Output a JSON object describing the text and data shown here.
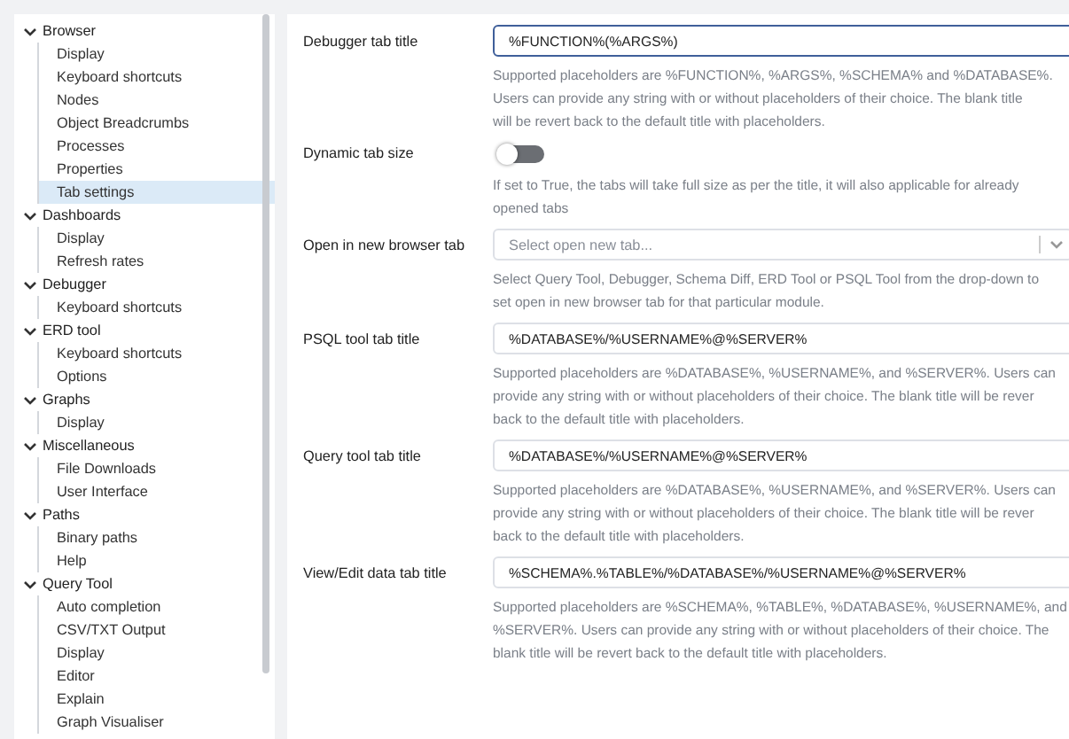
{
  "sidebar": {
    "items": [
      {
        "label": "Browser",
        "expanded": true,
        "children": [
          {
            "label": "Display",
            "selected": false
          },
          {
            "label": "Keyboard shortcuts",
            "selected": false
          },
          {
            "label": "Nodes",
            "selected": false
          },
          {
            "label": "Object Breadcrumbs",
            "selected": false
          },
          {
            "label": "Processes",
            "selected": false
          },
          {
            "label": "Properties",
            "selected": false
          },
          {
            "label": "Tab settings",
            "selected": true
          }
        ]
      },
      {
        "label": "Dashboards",
        "expanded": true,
        "children": [
          {
            "label": "Display",
            "selected": false
          },
          {
            "label": "Refresh rates",
            "selected": false
          }
        ]
      },
      {
        "label": "Debugger",
        "expanded": true,
        "children": [
          {
            "label": "Keyboard shortcuts",
            "selected": false
          }
        ]
      },
      {
        "label": "ERD tool",
        "expanded": true,
        "children": [
          {
            "label": "Keyboard shortcuts",
            "selected": false
          },
          {
            "label": "Options",
            "selected": false
          }
        ]
      },
      {
        "label": "Graphs",
        "expanded": true,
        "children": [
          {
            "label": "Display",
            "selected": false
          }
        ]
      },
      {
        "label": "Miscellaneous",
        "expanded": true,
        "children": [
          {
            "label": "File Downloads",
            "selected": false
          },
          {
            "label": "User Interface",
            "selected": false
          }
        ]
      },
      {
        "label": "Paths",
        "expanded": true,
        "children": [
          {
            "label": "Binary paths",
            "selected": false
          },
          {
            "label": "Help",
            "selected": false
          }
        ]
      },
      {
        "label": "Query Tool",
        "expanded": true,
        "children": [
          {
            "label": "Auto completion",
            "selected": false
          },
          {
            "label": "CSV/TXT Output",
            "selected": false
          },
          {
            "label": "Display",
            "selected": false
          },
          {
            "label": "Editor",
            "selected": false
          },
          {
            "label": "Explain",
            "selected": false
          },
          {
            "label": "Graph Visualiser",
            "selected": false
          }
        ]
      }
    ]
  },
  "settings": [
    {
      "kind": "text",
      "label": "Debugger tab title",
      "value": "%FUNCTION%(%ARGS%)",
      "focused": true,
      "help": [
        "Supported placeholders are %FUNCTION%, %ARGS%, %SCHEMA% and %DATABASE%.",
        "Users can provide any string with or without placeholders of their choice. The blank title",
        "will be revert back to the default title with placeholders."
      ]
    },
    {
      "kind": "switch",
      "label": "Dynamic tab size",
      "on": false,
      "help": [
        "If set to True, the tabs will take full size as per the title, it will also applicable for already",
        "opened tabs"
      ]
    },
    {
      "kind": "select",
      "label": "Open in new browser tab",
      "placeholder": "Select open new tab...",
      "help": [
        "Select Query Tool, Debugger, Schema Diff, ERD Tool or PSQL Tool from the drop-down to",
        "set open in new browser tab for that particular module."
      ]
    },
    {
      "kind": "text",
      "label": "PSQL tool tab title",
      "value": "%DATABASE%/%USERNAME%@%SERVER%",
      "focused": false,
      "help": [
        "Supported placeholders are %DATABASE%, %USERNAME%, and %SERVER%. Users can",
        "provide any string with or without placeholders of their choice. The blank title will be rever",
        "back to the default title with placeholders."
      ]
    },
    {
      "kind": "text",
      "label": "Query tool tab title",
      "value": "%DATABASE%/%USERNAME%@%SERVER%",
      "focused": false,
      "help": [
        "Supported placeholders are %DATABASE%, %USERNAME%, and %SERVER%. Users can",
        "provide any string with or without placeholders of their choice. The blank title will be rever",
        "back to the default title with placeholders."
      ]
    },
    {
      "kind": "text",
      "label": "View/Edit data tab title",
      "value": "%SCHEMA%.%TABLE%/%DATABASE%/%USERNAME%@%SERVER%",
      "focused": false,
      "help": [
        "Supported placeholders are %SCHEMA%, %TABLE%, %DATABASE%, %USERNAME%, and",
        "%SERVER%. Users can provide any string with or without placeholders of their choice. The",
        "blank title will be revert back to the default title with placeholders."
      ]
    }
  ]
}
